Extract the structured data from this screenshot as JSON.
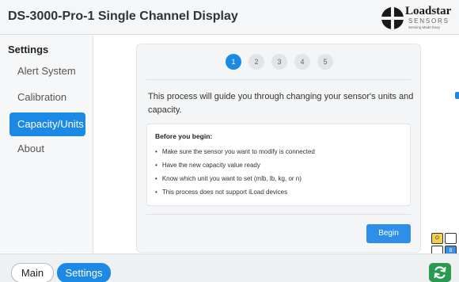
{
  "app": {
    "title": "DS-3000-Pro-1 Single Channel Display",
    "logo_brand": "Loadstar",
    "logo_sub": "SENSORS",
    "logo_tagline": "Sensing Made Easy"
  },
  "sidebar": {
    "heading": "Settings",
    "items": [
      {
        "label": "Alert System",
        "active": false
      },
      {
        "label": "Calibration",
        "active": false
      },
      {
        "label": "Capacity/Units",
        "active": true
      },
      {
        "label": "About",
        "active": false
      }
    ]
  },
  "wizard": {
    "steps": [
      "1",
      "2",
      "3",
      "4",
      "5"
    ],
    "current_step": 1,
    "intro": "This process will guide you through changing your sensor's units and capacity.",
    "before_heading": "Before you begin:",
    "checklist": [
      "Make sure the sensor you want to modify is connected",
      "Have the new capacity value ready",
      "Know which unit you want to set (mlb, lb, kg, or n)",
      "This process does not support iLoad devices"
    ],
    "begin_label": "Begin"
  },
  "status_grid": {
    "cells": [
      "O",
      "",
      "",
      "B"
    ],
    "colors": {
      "O": "#f4cf4e",
      "B": "#3a8fe0"
    }
  },
  "footer": {
    "tabs": [
      {
        "label": "Main",
        "active": false
      },
      {
        "label": "Settings",
        "active": true
      }
    ],
    "sync_icon": "sync-icon"
  },
  "colors": {
    "accent": "#1c89e5",
    "sync_green": "#2a9a52"
  }
}
